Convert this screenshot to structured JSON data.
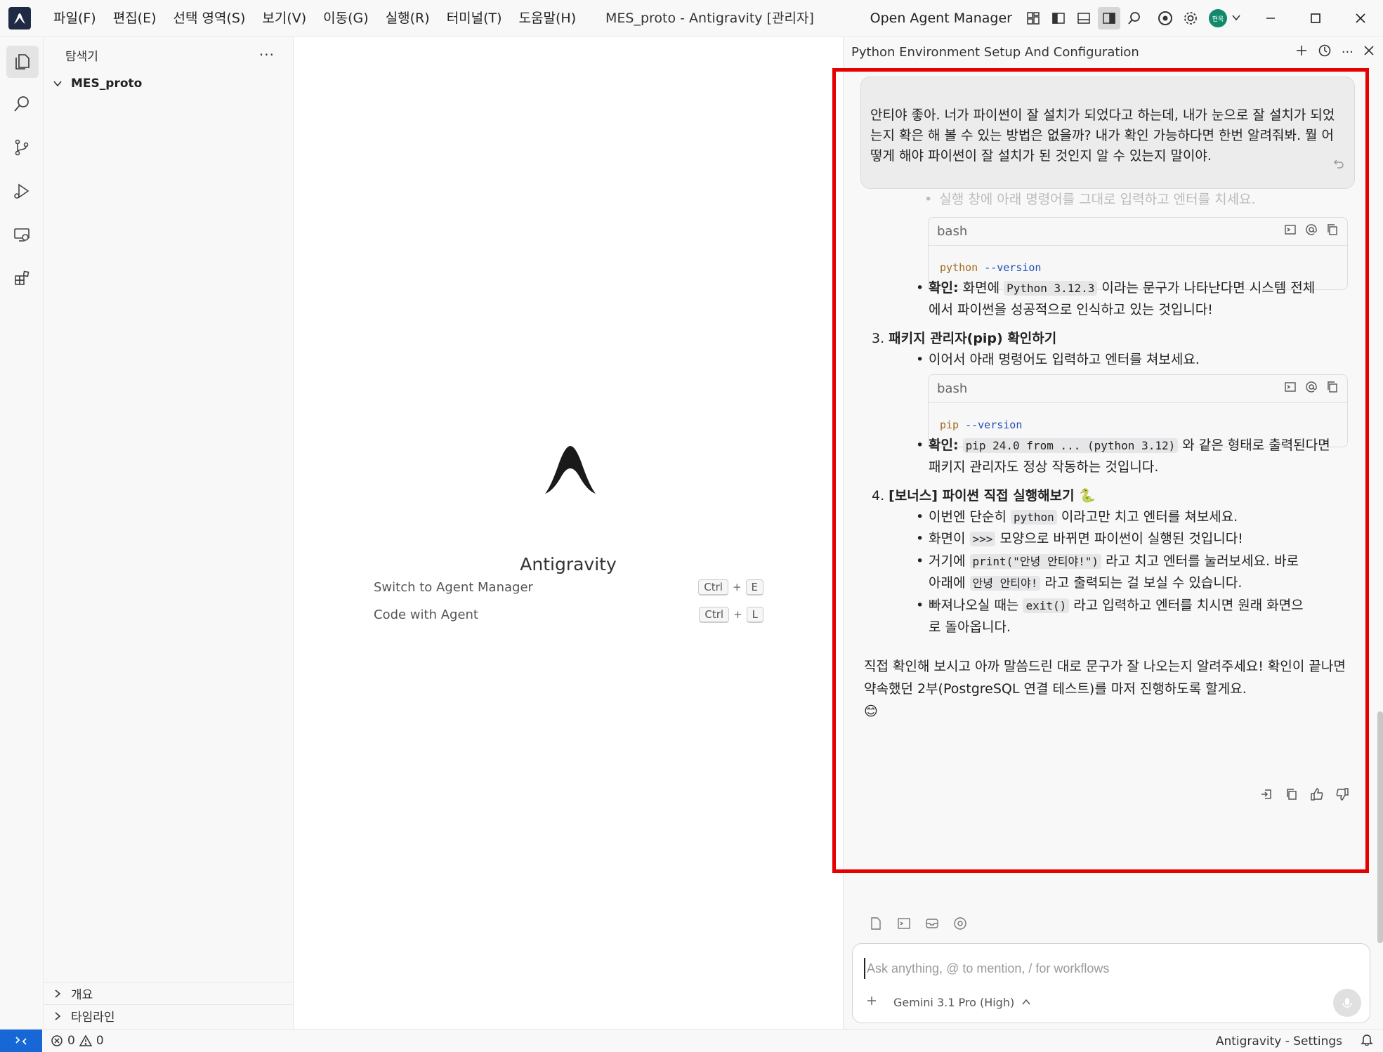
{
  "titlebar": {
    "menus": [
      "파일(F)",
      "편집(E)",
      "선택 영역(S)",
      "보기(V)",
      "이동(G)",
      "실행(R)",
      "터미널(T)",
      "도움말(H)"
    ],
    "window_title": "MES_proto - Antigravity [관리자]",
    "open_agent_manager": "Open Agent Manager",
    "avatar_text": "현욱"
  },
  "explorer": {
    "title": "탐색기",
    "root_folder": "MES_proto",
    "sections": [
      "개요",
      "타임라인"
    ]
  },
  "welcome": {
    "title": "Antigravity",
    "shortcuts": [
      {
        "label": "Switch to Agent Manager",
        "keys": [
          "Ctrl",
          "E"
        ]
      },
      {
        "label": "Code with Agent",
        "keys": [
          "Ctrl",
          "L"
        ]
      }
    ]
  },
  "agent": {
    "title": "Python Environment Setup And Configuration",
    "user_message": "안티야 좋아. 너가 파이썬이 잘 설치가 되었다고 하는데, 내가 눈으로 잘 설치가 되었는지 확은 해 볼 수 있는 방법은 없을까? 내가 확인 가능하다면 한번 알려줘봐. 뭘 어떻게 해야 파이썬이 잘 설치가 된 것인지 알 수 있는지 말이야.",
    "faded_line": "실행 창에 아래 명령어를 그대로 입력하고 엔터를 치세요.",
    "code1": {
      "lang": "bash",
      "cmd": "python",
      "flag": "--version"
    },
    "confirm1": {
      "label": "확인:",
      "pre": "화면에",
      "code": "Python 3.12.3",
      "line1": "이라는 문구가 나타난다면 시스템 전체",
      "line2": "에서 파이썬을 성공적으로 인식하고 있는 것입니다!"
    },
    "step3": {
      "num": "3.",
      "title": "패키지 관리자(pip) 확인하기",
      "bullet": "이어서 아래 명령어도 입력하고 엔터를 쳐보세요."
    },
    "code2": {
      "lang": "bash",
      "cmd": "pip",
      "flag": "--version"
    },
    "confirm2": {
      "label": "확인:",
      "code": "pip 24.0 from ... (python 3.12)",
      "line1": "와 같은 형태로 출력된다면",
      "line2": "패키지 관리자도 정상 작동하는 것입니다."
    },
    "step4": {
      "num": "4.",
      "title": "[보너스] 파이썬 직접 실행해보기",
      "emoji": "🐍"
    },
    "step4_bullets": {
      "b1_pre": "이번엔 단순히",
      "b1_code": "python",
      "b1_post": "이라고만 치고 엔터를 쳐보세요.",
      "b2_pre": "화면이",
      "b2_code": ">>>",
      "b2_post": "모양으로 바뀌면 파이썬이 실행된 것입니다!",
      "b3_pre": "거기에",
      "b3_code": "print(\"안녕 안티야!\")",
      "b3_post": "라고 치고 엔터를 눌러보세요. 바로",
      "b3_line2_pre": "아래에",
      "b3_code2": "안녕 안티야!",
      "b3_line2_post": "라고 출력되는 걸 보실 수 있습니다.",
      "b4_pre": "빠져나오실 때는",
      "b4_code": "exit()",
      "b4_post": "라고 입력하고 엔터를 치시면 원래 화면으",
      "b4_line2": "로 돌아옵니다."
    },
    "closing": "직접 확인해 보시고 아까 말씀드린 대로 문구가 잘 나오는지 알려주세요! 확인이 끝나면 약속했던 2부(PostgreSQL 연결 테스트)를 마저 진행하도록 할게요.",
    "closing_emoji": "😊",
    "input_placeholder": "Ask anything, @ to mention, / for workflows",
    "model": "Gemini 3.1 Pro (High)"
  },
  "status": {
    "errors": "0",
    "warnings": "0",
    "settings": "Antigravity - Settings"
  },
  "colors": {
    "highlight": "#e60000",
    "remote": "#1768d6",
    "code_cmd": "#a06a1c",
    "code_flag": "#1f4fb5"
  }
}
